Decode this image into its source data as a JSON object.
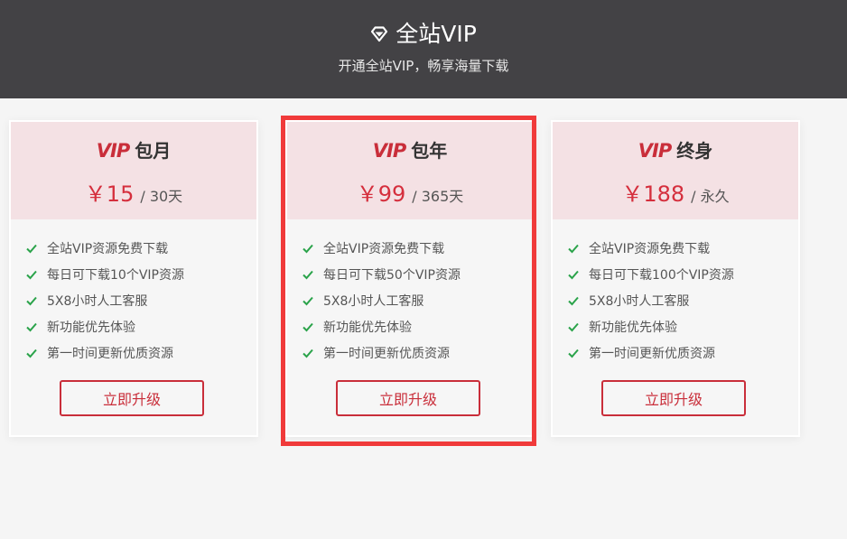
{
  "header": {
    "title": "全站VIP",
    "subtitle": "开通全站VIP，畅享海量下载"
  },
  "plans": [
    {
      "logo": "VIP",
      "name": "包月",
      "price": "￥15",
      "period": "/ 30天",
      "features": [
        "全站VIP资源免费下载",
        "每日可下载10个VIP资源",
        "5X8小时人工客服",
        "新功能优先体验",
        "第一时间更新优质资源"
      ],
      "button": "立即升级"
    },
    {
      "logo": "VIP",
      "name": "包年",
      "price": "￥99",
      "period": "/ 365天",
      "features": [
        "全站VIP资源免费下载",
        "每日可下载50个VIP资源",
        "5X8小时人工客服",
        "新功能优先体验",
        "第一时间更新优质资源"
      ],
      "button": "立即升级"
    },
    {
      "logo": "VIP",
      "name": "终身",
      "price": "￥188",
      "period": "/ 永久",
      "features": [
        "全站VIP资源免费下载",
        "每日可下载100个VIP资源",
        "5X8小时人工客服",
        "新功能优先体验",
        "第一时间更新优质资源"
      ],
      "button": "立即升级"
    }
  ],
  "colors": {
    "header_bg": "#434245",
    "card_top_bg": "#f4e1e4",
    "accent": "#c92e3a",
    "price": "#d52f3d",
    "check": "#2aa34a",
    "highlight": "#f03a3a"
  },
  "icons": {
    "header": "diamond-icon",
    "feature": "check-icon"
  },
  "highlighted_plan": "包年"
}
